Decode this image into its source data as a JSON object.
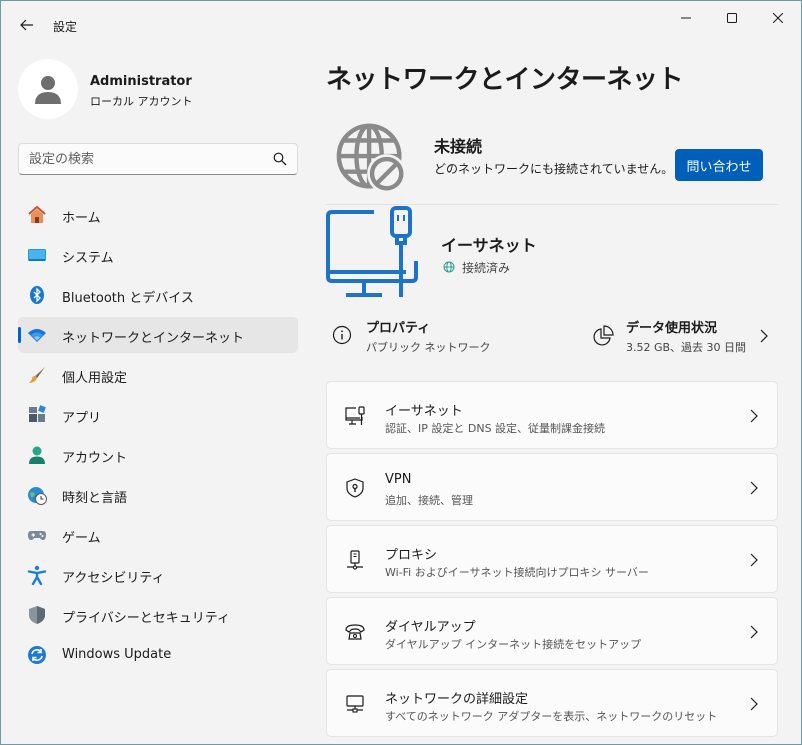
{
  "window": {
    "title": "設定"
  },
  "profile": {
    "name": "Administrator",
    "account_type": "ローカル アカウント"
  },
  "search": {
    "placeholder": "設定の検索"
  },
  "sidebar": {
    "items": [
      {
        "label": "ホーム",
        "icon": "home-icon"
      },
      {
        "label": "システム",
        "icon": "system-icon"
      },
      {
        "label": "Bluetooth とデバイス",
        "icon": "bluetooth-icon"
      },
      {
        "label": "ネットワークとインターネット",
        "icon": "wifi-icon",
        "selected": true
      },
      {
        "label": "個人用設定",
        "icon": "brush-icon"
      },
      {
        "label": "アプリ",
        "icon": "apps-icon"
      },
      {
        "label": "アカウント",
        "icon": "account-icon"
      },
      {
        "label": "時刻と言語",
        "icon": "clock-globe-icon"
      },
      {
        "label": "ゲーム",
        "icon": "gamepad-icon"
      },
      {
        "label": "アクセシビリティ",
        "icon": "accessibility-icon"
      },
      {
        "label": "プライバシーとセキュリティ",
        "icon": "shield-icon"
      },
      {
        "label": "Windows Update",
        "icon": "update-icon"
      }
    ]
  },
  "main": {
    "title": "ネットワークとインターネット",
    "status": {
      "title": "未接続",
      "description": "どのネットワークにも接続されていません。",
      "button_label": "問い合わせ"
    },
    "ethernet": {
      "title": "イーサネット",
      "status": "接続済み"
    },
    "properties": {
      "title": "プロパティ",
      "subtitle": "パブリック ネットワーク"
    },
    "data_usage": {
      "title": "データ使用状況",
      "subtitle": "3.52 GB、過去 30 日間"
    },
    "cards": [
      {
        "title": "イーサネット",
        "subtitle": "認証、IP 設定と DNS 設定、従量制課金接続",
        "icon": "ethernet-icon"
      },
      {
        "title": "VPN",
        "subtitle": "追加、接続、管理",
        "icon": "vpn-shield-icon"
      },
      {
        "title": "プロキシ",
        "subtitle": "Wi-Fi およびイーサネット接続向けプロキシ サーバー",
        "icon": "proxy-icon"
      },
      {
        "title": "ダイヤルアップ",
        "subtitle": "ダイヤルアップ インターネット接続をセットアップ",
        "icon": "dialup-icon"
      },
      {
        "title": "ネットワークの詳細設定",
        "subtitle": "すべてのネットワーク アダプターを表示、ネットワークのリセット",
        "icon": "advanced-network-icon"
      }
    ]
  },
  "colors": {
    "accent": "#005fb8",
    "selection_bar": "#0067c0",
    "window_bg": "#f3f3f3",
    "card_bg": "#fbfbfb"
  }
}
